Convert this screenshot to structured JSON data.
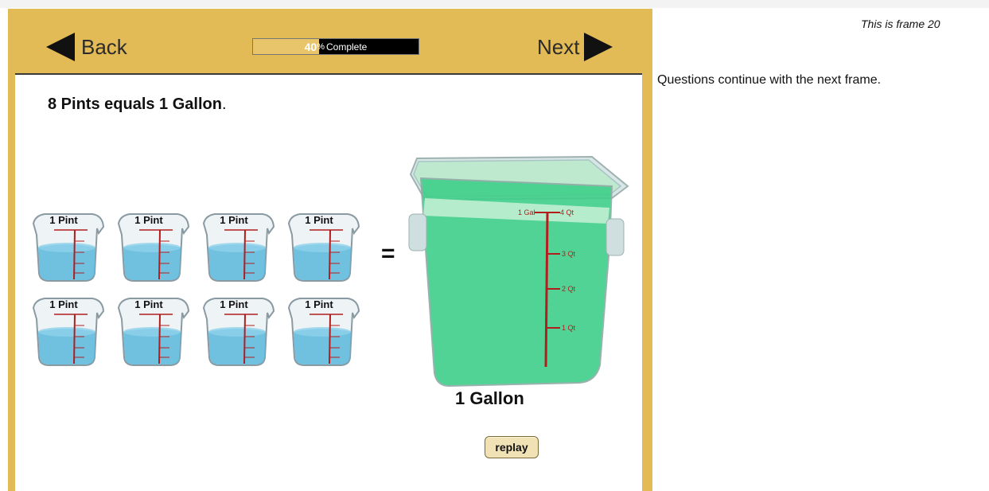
{
  "nav": {
    "back_label": "Back",
    "next_label": "Next",
    "progress": {
      "value_percent": 40,
      "value_text": "40",
      "percent_sign": "%",
      "suffix_text": "Complete"
    }
  },
  "content": {
    "statement_bold": "8 Pints equals 1 Gallon",
    "statement_end": ".",
    "pint_label": "1 Pint",
    "pint_count": 8,
    "equals_sign": "=",
    "gallon_label": "1 Gallon",
    "gallon_marks": [
      "1 Gal",
      "4 Qt",
      "3 Qt",
      "2 Qt",
      "1 Qt"
    ],
    "replay_label": "replay"
  },
  "sidebar": {
    "frame_text": "This is frame 20",
    "message": "Questions continue with the next frame."
  },
  "colors": {
    "frame_gold": "#e2bb57",
    "water_blue": "#59b7dc",
    "gallon_green": "#3fcf8a",
    "measure_red": "#b21e1e"
  }
}
